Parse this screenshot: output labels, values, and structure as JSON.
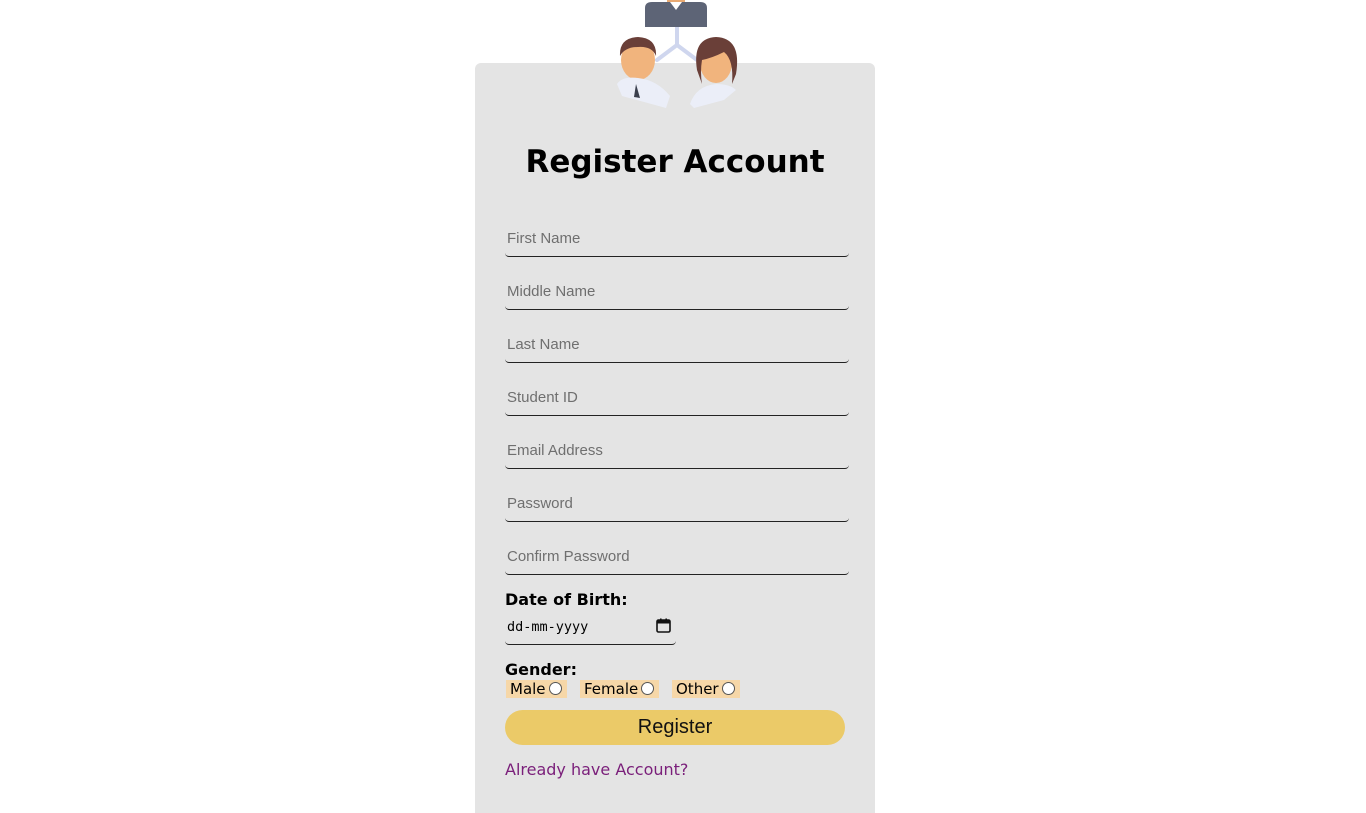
{
  "form": {
    "title": "Register Account",
    "fields": [
      {
        "placeholder": "First Name",
        "value": ""
      },
      {
        "placeholder": "Middle Name",
        "value": ""
      },
      {
        "placeholder": "Last Name",
        "value": ""
      },
      {
        "placeholder": "Student ID",
        "value": ""
      },
      {
        "placeholder": "Email Address",
        "value": ""
      },
      {
        "placeholder": "Password",
        "value": ""
      },
      {
        "placeholder": "Confirm Password",
        "value": ""
      }
    ],
    "dob_label": "Date of Birth:",
    "dob_placeholder": "dd-mm-yyyy",
    "gender_label": "Gender:",
    "gender_options": [
      "Male",
      "Female",
      "Other"
    ],
    "submit_label": "Register",
    "login_link": "Already have Account?"
  },
  "icons": {
    "logo": "users-group-icon",
    "calendar": "calendar-icon"
  },
  "colors": {
    "card_bg": "#e4e4e4",
    "button_bg": "#ebca68",
    "radio_option_bg": "#f6d7a8",
    "link": "#7a1f7a"
  }
}
